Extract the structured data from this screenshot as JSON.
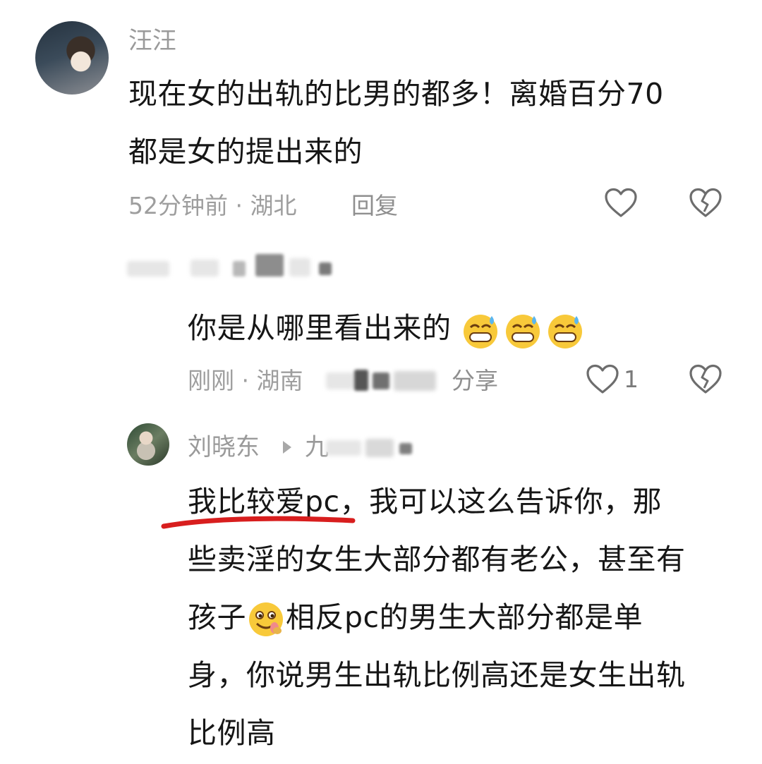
{
  "comment1": {
    "username": "汪汪",
    "line1": "现在女的出轨的比男的都多！离婚百分70",
    "line2": "都是女的提出来的",
    "time_location": "52分钟前 · 湖北",
    "reply_label": "回复"
  },
  "reply1": {
    "text": "你是从哪里看出来的",
    "emoji": "grinning-sweat-emoji",
    "time_location": "刚刚 · 湖南",
    "share_label": "分享",
    "like_count": "1"
  },
  "comment2": {
    "username": "刘晓东",
    "reply_to_prefix": "九",
    "line1_underlined": "我比较爱pc",
    "line1_rest": "，我可以这么告诉你，那",
    "line2": "些卖淫的女生大部分都有老公，甚至有",
    "line3_a": "孩子",
    "line3_b": "相反pc的男生大部分都是单",
    "line4": "身，你说男生出轨比例高还是女生出轨",
    "line5": "比例高"
  },
  "colors": {
    "text": "#161616",
    "meta": "#9e9e9e",
    "underline": "#d81e1e",
    "icon": "#6d6d6d"
  }
}
